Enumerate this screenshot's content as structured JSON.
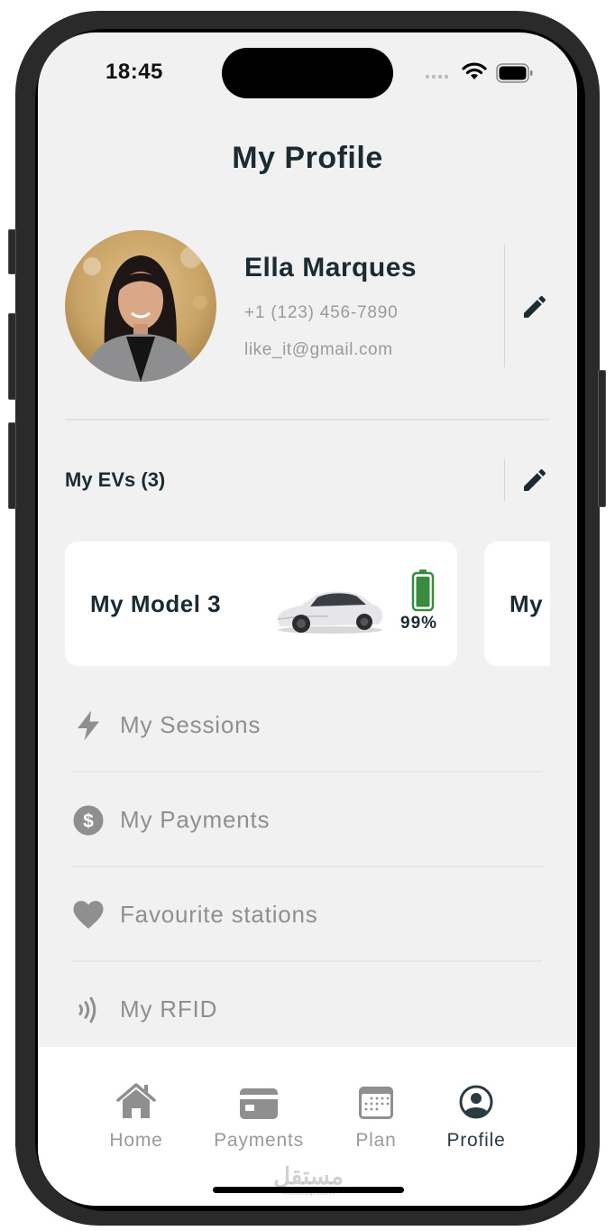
{
  "status_bar": {
    "time": "18:45",
    "signal_icon": "cellular-signal-icon",
    "wifi_icon": "wifi-icon",
    "battery_icon": "battery-icon"
  },
  "header": {
    "title": "My Profile"
  },
  "profile": {
    "name": "Ella Marques",
    "phone": "+1 (123) 456-7890",
    "email": "like_it@gmail.com",
    "avatar_icon": "user-photo",
    "edit_icon": "pencil-icon"
  },
  "evs": {
    "title": "My EVs (3)",
    "edit_icon": "pencil-icon",
    "cards": [
      {
        "name": "My Model 3",
        "battery_percent_label": "99%",
        "battery_level": 0.99,
        "battery_color": "#3a8a3f",
        "image": "car-image"
      },
      {
        "name": "My"
      }
    ]
  },
  "menu": {
    "items": [
      {
        "label": "My Sessions",
        "icon": "lightning-icon"
      },
      {
        "label": "My Payments",
        "icon": "dollar-icon"
      },
      {
        "label": "Favourite stations",
        "icon": "heart-icon"
      },
      {
        "label": "My RFID",
        "icon": "rfid-icon"
      }
    ]
  },
  "tabbar": {
    "tabs": [
      {
        "label": "Home",
        "icon": "home-icon",
        "active": false
      },
      {
        "label": "Payments",
        "icon": "credit-card-icon",
        "active": false
      },
      {
        "label": "Plan",
        "icon": "calendar-icon",
        "active": false
      },
      {
        "label": "Profile",
        "icon": "profile-icon",
        "active": true
      }
    ]
  },
  "watermark": {
    "arabic": "مستقل",
    "latin": "mostaql.com"
  },
  "colors": {
    "title_text": "#1c2b33",
    "muted_text": "#9a9a9a",
    "screen_bg": "#f1f1f1",
    "card_bg": "#ffffff",
    "battery_green": "#3a8a3f"
  }
}
